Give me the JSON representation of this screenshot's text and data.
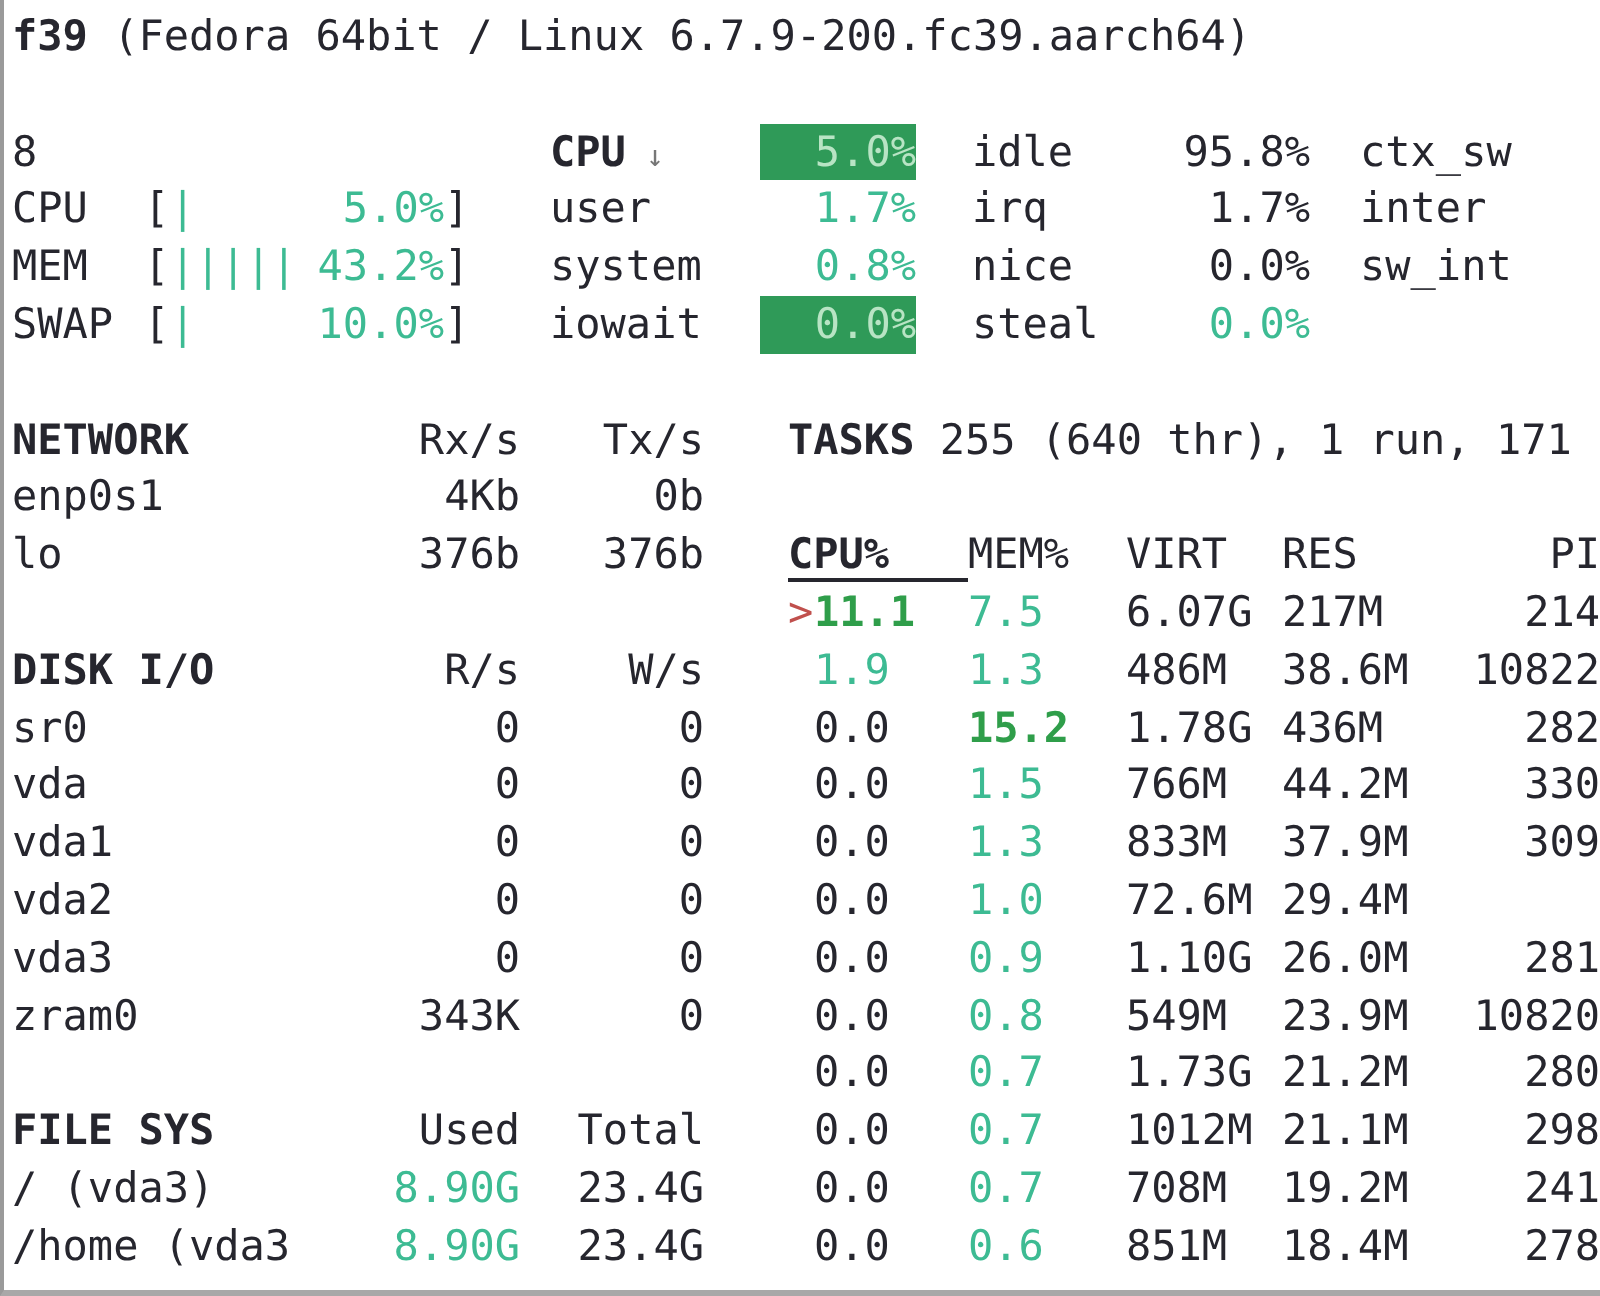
{
  "title": "**f39** (Fedora 64bit / Linux 6.7.9-200.fc39.aarch64)",
  "quicklook": {
    "cores": "8",
    "gauges": [
      {
        "label": "CPU",
        "open": "[",
        "bars": "|",
        "value": "5.0%",
        "close": "]"
      },
      {
        "label": "MEM",
        "open": "[",
        "bars": "|||||",
        "value": "43.2%",
        "close": "]"
      },
      {
        "label": "SWAP",
        "open": "[",
        "bars": "|",
        "value": "10.0%",
        "close": "]"
      }
    ]
  },
  "cpu": {
    "header": "CPU",
    "sort_icon": "↓",
    "total": {
      "text": "5.0%",
      "kind": "alert"
    },
    "stats": [
      {
        "label": "user",
        "value": {
          "text": "1.7%",
          "kind": "ok"
        }
      },
      {
        "label": "system",
        "value": {
          "text": "0.8%",
          "kind": "ok"
        }
      },
      {
        "label": "iowait",
        "value": {
          "text": "0.0%",
          "kind": "alert"
        }
      }
    ],
    "stats_2": [
      {
        "label": "idle",
        "value": {
          "text": "95.8%",
          "kind": "plain"
        }
      },
      {
        "label": "irq",
        "value": {
          "text": "1.7%",
          "kind": "plain"
        }
      },
      {
        "label": "nice",
        "value": {
          "text": "0.0%",
          "kind": "plain"
        }
      },
      {
        "label": "steal",
        "value": {
          "text": "0.0%",
          "kind": "ok"
        }
      }
    ],
    "stats_3": [
      "ctx_sw",
      "inter",
      "sw_int"
    ]
  },
  "sections": [
    {
      "header": "NETWORK",
      "columns": [
        "Rx/s",
        "Tx/s"
      ],
      "rows": [
        {
          "name": "enp0s1",
          "values": [
            {
              "text": "4Kb",
              "kind": "plain"
            },
            {
              "text": "0b",
              "kind": "plain"
            }
          ]
        },
        {
          "name": "lo",
          "values": [
            {
              "text": "376b",
              "kind": "plain"
            },
            {
              "text": "376b",
              "kind": "plain"
            }
          ]
        }
      ]
    },
    {
      "header": "DISK I/O",
      "columns": [
        "R/s",
        "W/s"
      ],
      "rows": [
        {
          "name": "sr0",
          "values": [
            {
              "text": "0",
              "kind": "plain"
            },
            {
              "text": "0",
              "kind": "plain"
            }
          ]
        },
        {
          "name": "vda",
          "values": [
            {
              "text": "0",
              "kind": "plain"
            },
            {
              "text": "0",
              "kind": "plain"
            }
          ]
        },
        {
          "name": "vda1",
          "values": [
            {
              "text": "0",
              "kind": "plain"
            },
            {
              "text": "0",
              "kind": "plain"
            }
          ]
        },
        {
          "name": "vda2",
          "values": [
            {
              "text": "0",
              "kind": "plain"
            },
            {
              "text": "0",
              "kind": "plain"
            }
          ]
        },
        {
          "name": "vda3",
          "values": [
            {
              "text": "0",
              "kind": "plain"
            },
            {
              "text": "0",
              "kind": "plain"
            }
          ]
        },
        {
          "name": "zram0",
          "values": [
            {
              "text": "343K",
              "kind": "plain"
            },
            {
              "text": "0",
              "kind": "plain"
            }
          ]
        }
      ]
    },
    {
      "header": "FILE SYS",
      "columns": [
        "Used",
        "Total"
      ],
      "rows": [
        {
          "name": "/ (vda3)",
          "values": [
            {
              "text": "8.90G",
              "kind": "ok"
            },
            {
              "text": "23.4G",
              "kind": "plain"
            }
          ]
        },
        {
          "name": "/home (vda3",
          "values": [
            {
              "text": "8.90G",
              "kind": "ok"
            },
            {
              "text": "23.4G",
              "kind": "plain"
            }
          ]
        }
      ]
    }
  ],
  "processes": {
    "summary_label": "TASKS",
    "summary": "255 (640 thr), 1 run, 171",
    "columns": [
      {
        "label": "CPU%",
        "sorted": true
      },
      {
        "label": "MEM%",
        "sorted": false
      },
      {
        "label": "VIRT",
        "sorted": false
      },
      {
        "label": "RES",
        "sorted": false
      },
      {
        "label": "PI",
        "sorted": false
      }
    ],
    "rows": [
      {
        "marker": ">",
        "cpu": {
          "text": "11.1",
          "kind": "high"
        },
        "mem": {
          "text": "7.5",
          "kind": "ok"
        },
        "virt": "6.07G",
        "res": "217M",
        "pid": "214"
      },
      {
        "cpu": {
          "text": "1.9",
          "kind": "ok"
        },
        "mem": {
          "text": "1.3",
          "kind": "ok"
        },
        "virt": "486M",
        "res": "38.6M",
        "pid": "10822"
      },
      {
        "cpu": {
          "text": "0.0",
          "kind": "plain"
        },
        "mem": {
          "text": "15.2",
          "kind": "high"
        },
        "virt": "1.78G",
        "res": "436M",
        "pid": "282"
      },
      {
        "cpu": {
          "text": "0.0",
          "kind": "plain"
        },
        "mem": {
          "text": "1.5",
          "kind": "ok"
        },
        "virt": "766M",
        "res": "44.2M",
        "pid": "330"
      },
      {
        "cpu": {
          "text": "0.0",
          "kind": "plain"
        },
        "mem": {
          "text": "1.3",
          "kind": "ok"
        },
        "virt": "833M",
        "res": "37.9M",
        "pid": "309"
      },
      {
        "cpu": {
          "text": "0.0",
          "kind": "plain"
        },
        "mem": {
          "text": "1.0",
          "kind": "ok"
        },
        "virt": "72.6M",
        "res": "29.4M"
      },
      {
        "cpu": {
          "text": "0.0",
          "kind": "plain"
        },
        "mem": {
          "text": "0.9",
          "kind": "ok"
        },
        "virt": "1.10G",
        "res": "26.0M",
        "pid": "281"
      },
      {
        "cpu": {
          "text": "0.0",
          "kind": "plain"
        },
        "mem": {
          "text": "0.8",
          "kind": "ok"
        },
        "virt": "549M",
        "res": "23.9M",
        "pid": "10820"
      },
      {
        "cpu": {
          "text": "0.0",
          "kind": "plain"
        },
        "mem": {
          "text": "0.7",
          "kind": "ok"
        },
        "virt": "1.73G",
        "res": "21.2M",
        "pid": "280"
      },
      {
        "cpu": {
          "text": "0.0",
          "kind": "plain"
        },
        "mem": {
          "text": "0.7",
          "kind": "ok"
        },
        "virt": "1012M",
        "res": "21.1M",
        "pid": "298"
      },
      {
        "cpu": {
          "text": "0.0",
          "kind": "plain"
        },
        "mem": {
          "text": "0.7",
          "kind": "ok"
        },
        "virt": "708M",
        "res": "19.2M",
        "pid": "241"
      },
      {
        "cpu": {
          "text": "0.0",
          "kind": "plain"
        },
        "mem": {
          "text": "0.6",
          "kind": "ok"
        },
        "virt": "851M",
        "res": "18.4M",
        "pid": "278"
      }
    ]
  }
}
